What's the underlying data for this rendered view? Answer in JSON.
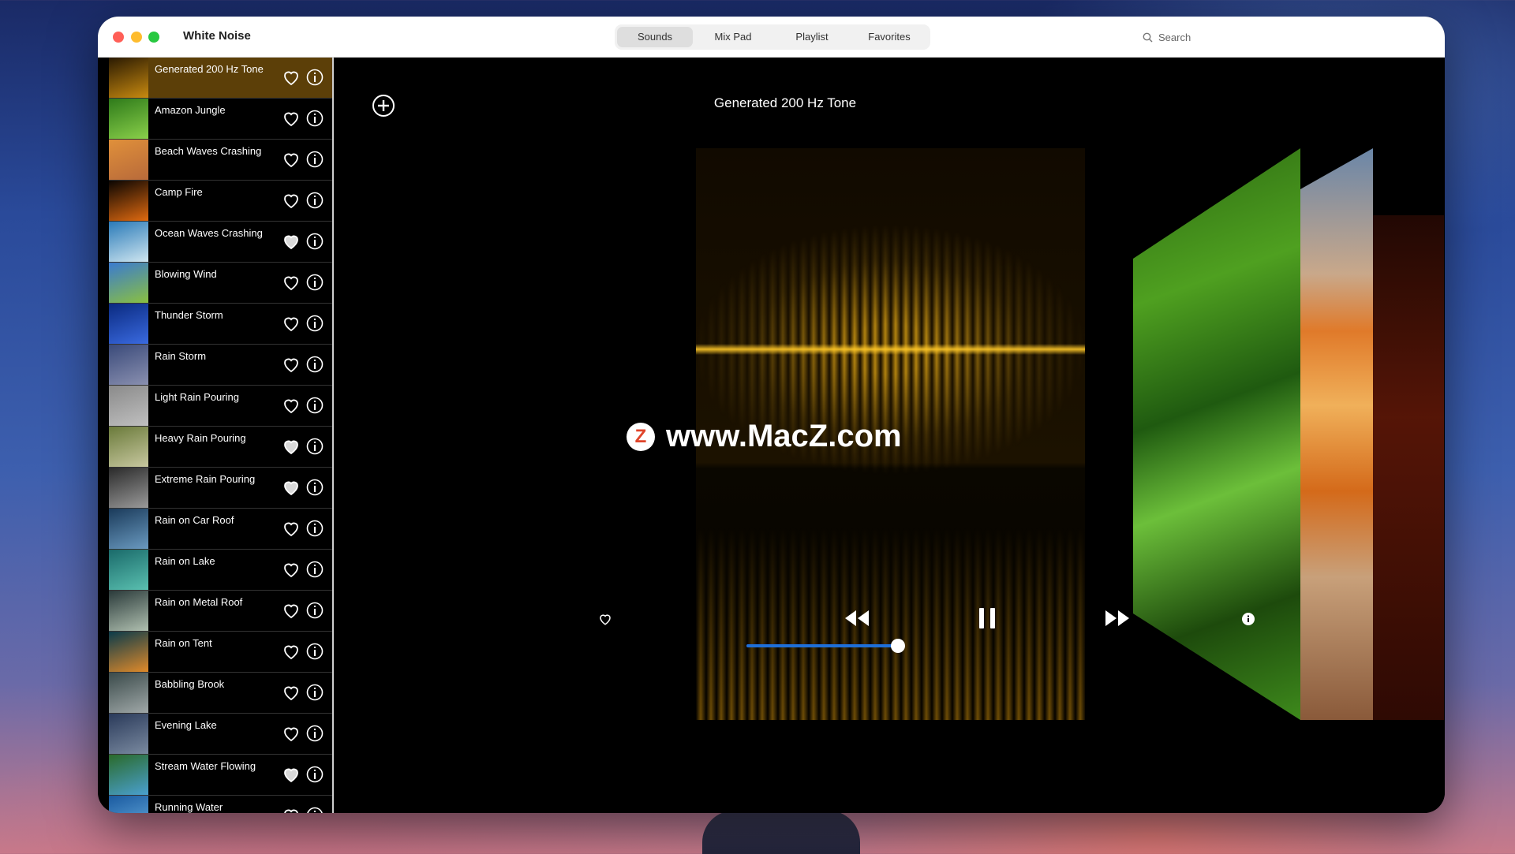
{
  "window": {
    "title": "White Noise"
  },
  "tabs": [
    {
      "label": "Sounds",
      "active": true
    },
    {
      "label": "Mix Pad",
      "active": false
    },
    {
      "label": "Playlist",
      "active": false
    },
    {
      "label": "Favorites",
      "active": false
    }
  ],
  "search": {
    "placeholder": "Search"
  },
  "sidebar": {
    "items": [
      {
        "label": "Generated 200 Hz Tone",
        "favorite": false,
        "selected": true,
        "thumb_colors": [
          "#2a1a02",
          "#c88a10"
        ]
      },
      {
        "label": "Amazon Jungle",
        "favorite": false,
        "thumb_colors": [
          "#2e7a1a",
          "#8ad04a"
        ]
      },
      {
        "label": "Beach Waves Crashing",
        "favorite": false,
        "thumb_colors": [
          "#e0903a",
          "#b86a3a"
        ]
      },
      {
        "label": "Camp Fire",
        "favorite": false,
        "thumb_colors": [
          "#0a0502",
          "#e06a10"
        ]
      },
      {
        "label": "Ocean Waves Crashing",
        "favorite": true,
        "thumb_colors": [
          "#2a7ab8",
          "#cfe6f0"
        ]
      },
      {
        "label": "Blowing Wind",
        "favorite": false,
        "thumb_colors": [
          "#3a7ad0",
          "#8ac040"
        ]
      },
      {
        "label": "Thunder Storm",
        "favorite": false,
        "thumb_colors": [
          "#0a2a80",
          "#3a6ae0"
        ]
      },
      {
        "label": "Rain Storm",
        "favorite": false,
        "thumb_colors": [
          "#3a4a7a",
          "#8a90b0"
        ]
      },
      {
        "label": "Light Rain Pouring",
        "favorite": false,
        "thumb_colors": [
          "#8a8a8a",
          "#c0c0c0"
        ]
      },
      {
        "label": "Heavy Rain Pouring",
        "favorite": true,
        "thumb_colors": [
          "#6a7a3a",
          "#c8c8a0"
        ]
      },
      {
        "label": "Extreme Rain Pouring",
        "favorite": true,
        "thumb_colors": [
          "#2a2a2a",
          "#9a9a9a"
        ]
      },
      {
        "label": "Rain on Car Roof",
        "favorite": false,
        "thumb_colors": [
          "#1a3a5a",
          "#6a9ac0"
        ]
      },
      {
        "label": "Rain on Lake",
        "favorite": false,
        "thumb_colors": [
          "#1a6a6a",
          "#5ac0b0"
        ]
      },
      {
        "label": "Rain on Metal Roof",
        "favorite": false,
        "thumb_colors": [
          "#2a3a3a",
          "#b0c0b0"
        ]
      },
      {
        "label": "Rain on Tent",
        "favorite": false,
        "thumb_colors": [
          "#0a3a4a",
          "#e08a2a"
        ]
      },
      {
        "label": "Babbling Brook",
        "favorite": false,
        "thumb_colors": [
          "#3a4a4a",
          "#a0a8a8"
        ]
      },
      {
        "label": "Evening Lake",
        "favorite": false,
        "thumb_colors": [
          "#2a3a5a",
          "#7a8aa0"
        ]
      },
      {
        "label": "Stream Water Flowing",
        "favorite": true,
        "thumb_colors": [
          "#2a6a2a",
          "#4aa0d0"
        ]
      },
      {
        "label": "Running Water",
        "favorite": false,
        "thumb_colors": [
          "#1a5aa0",
          "#6ab0e0"
        ]
      }
    ]
  },
  "player": {
    "now_playing": "Generated 200 Hz Tone",
    "volume": 1.0
  },
  "watermark": {
    "logo": "Z",
    "text": "www.MacZ.com"
  },
  "colors": {
    "accent": "#1e6fd9",
    "selected_row": "#5c3f08",
    "wave": "#e6aa14"
  }
}
